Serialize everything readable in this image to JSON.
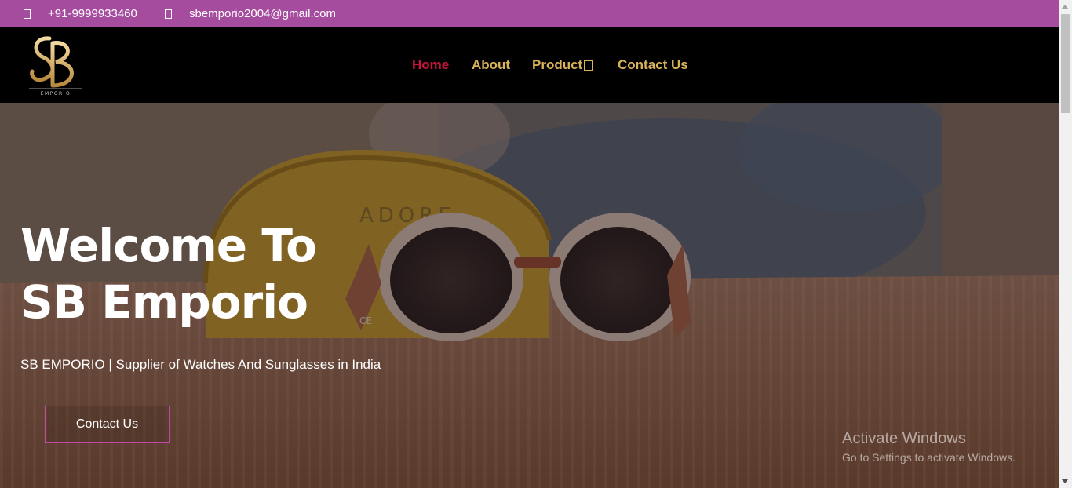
{
  "topbar": {
    "phone": "+91-9999933460",
    "email": "sbemporio2004@gmail.com",
    "phone_icon": "phone-icon",
    "email_icon": "envelope-icon"
  },
  "brand": {
    "logo_text": "SB",
    "logo_sub": "EMPORIO"
  },
  "nav": {
    "items": [
      {
        "label": "Home",
        "active": true
      },
      {
        "label": "About",
        "active": false
      },
      {
        "label": "Product",
        "active": false,
        "icon": "chevron-down-icon"
      },
      {
        "label": "Contact Us",
        "active": false
      }
    ]
  },
  "hero": {
    "title_line1": "Welcome To",
    "title_line2": "SB Emporio",
    "subtitle": "SB EMPORIO | Supplier of Watches And Sunglasses in India",
    "cta_label": "Contact Us",
    "case_text": "ADORE"
  },
  "watermark": {
    "line1": "Activate Windows",
    "line2": "Go to Settings to activate Windows."
  },
  "colors": {
    "topbar": "#a64c9f",
    "nav_link": "#d9b25a",
    "nav_active": "#c8143c",
    "cta_border": "#c04aa6"
  }
}
